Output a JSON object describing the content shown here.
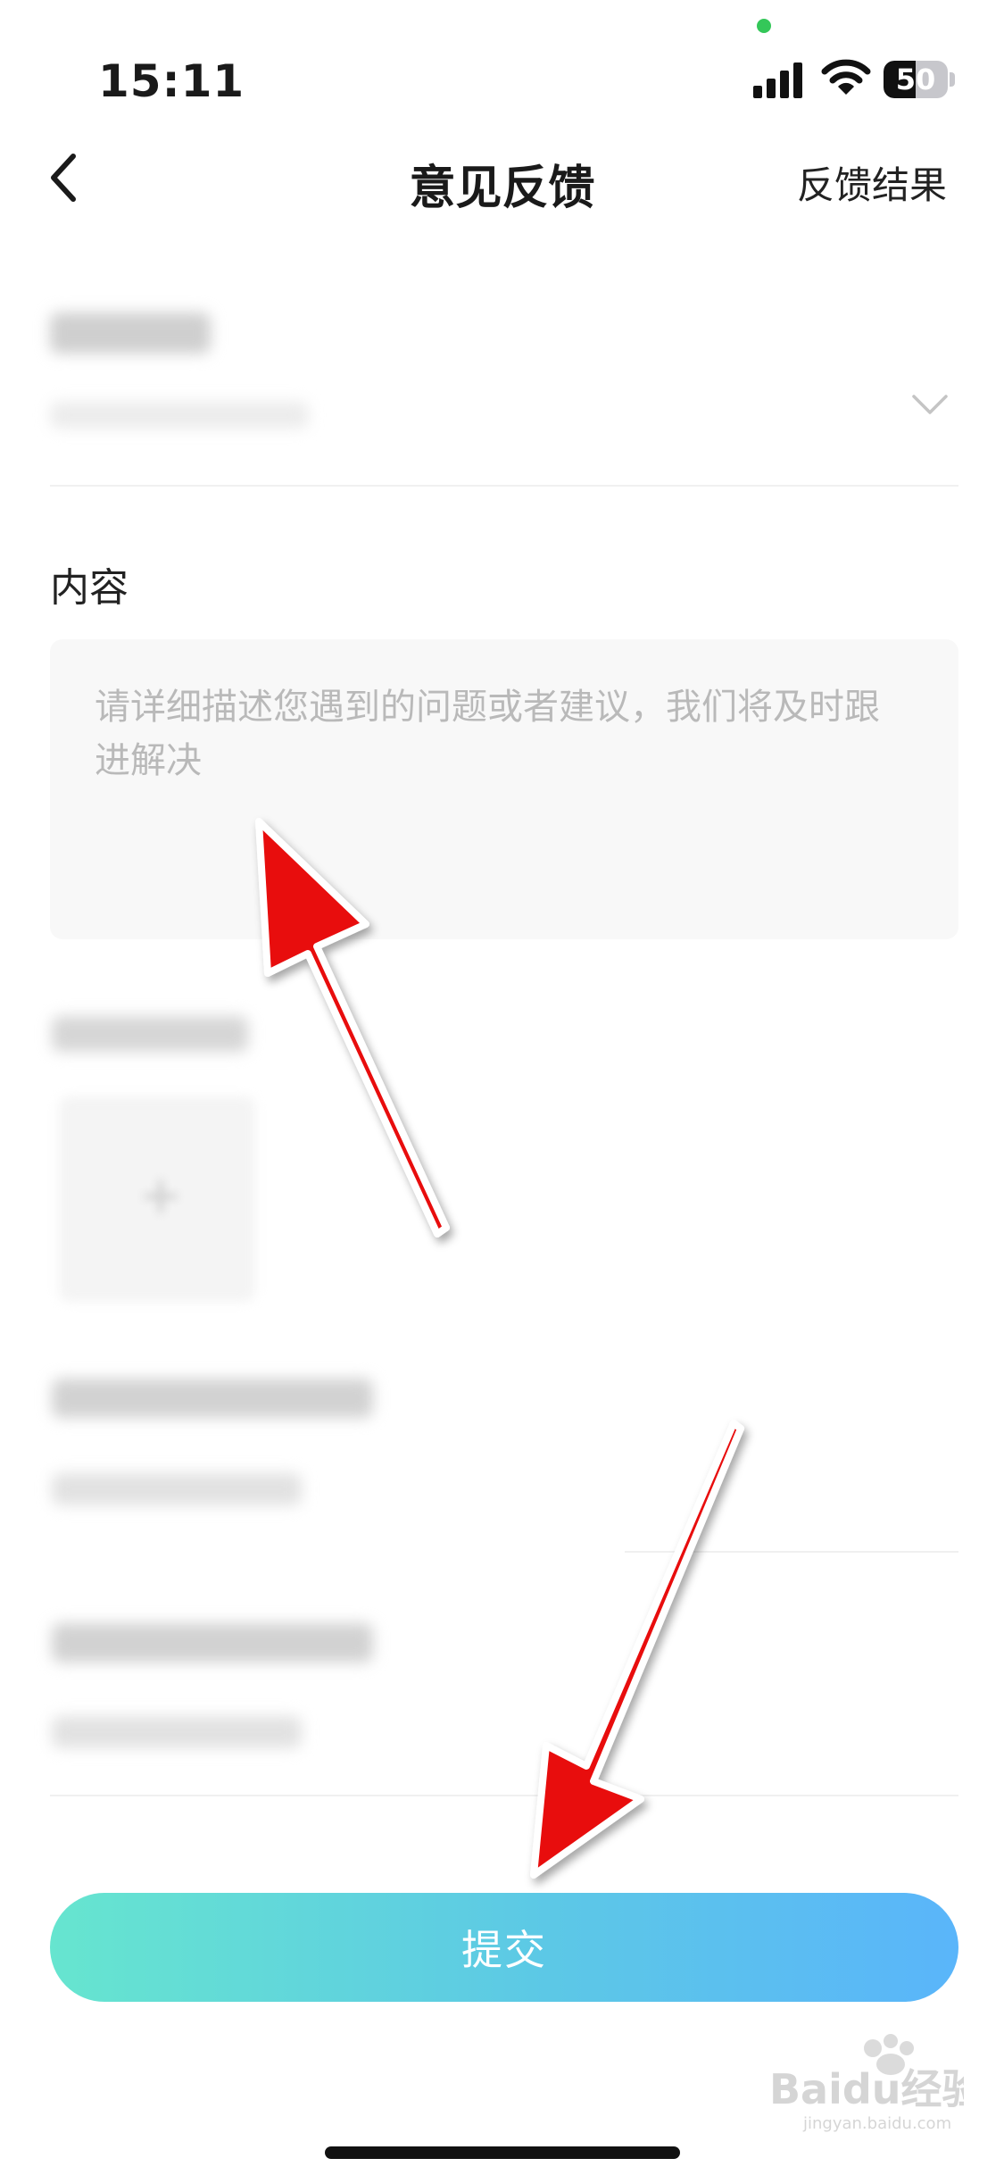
{
  "status_bar": {
    "time": "15:11",
    "battery_level": "50",
    "battery_fraction": 0.5,
    "icons": [
      "signal-icon",
      "wifi-icon",
      "battery-icon"
    ]
  },
  "nav": {
    "back_icon": "chevron-left-icon",
    "title": "意见反馈",
    "right_action": "反馈结果"
  },
  "category": {
    "icon": "chevron-down-icon"
  },
  "content": {
    "label": "内容",
    "placeholder": "请详细描述您遇到的问题或者建议，我们将及时跟进解决",
    "value": ""
  },
  "upload": {
    "icon": "plus-icon"
  },
  "submit": {
    "label": "提交"
  },
  "colors": {
    "submit_gradient_start": "#66e5cf",
    "submit_gradient_end": "#5ab5fa",
    "annotation_arrow": "#e8080a"
  },
  "watermark": {
    "text": "Baidu经验",
    "sub": "jingyan.baidu.com"
  }
}
